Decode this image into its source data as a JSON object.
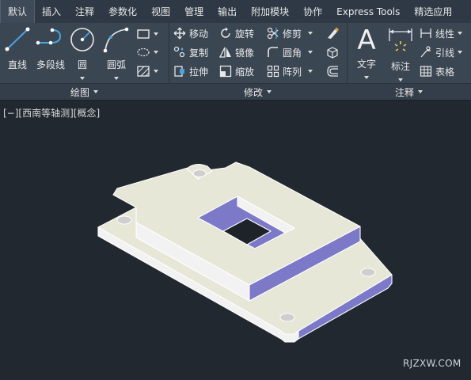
{
  "tabs": [
    {
      "label": "默认",
      "active": true
    },
    {
      "label": "插入"
    },
    {
      "label": "注释"
    },
    {
      "label": "参数化"
    },
    {
      "label": "视图"
    },
    {
      "label": "管理"
    },
    {
      "label": "输出"
    },
    {
      "label": "附加模块"
    },
    {
      "label": "协作"
    },
    {
      "label": "Express Tools"
    },
    {
      "label": "精选应用"
    }
  ],
  "panels": {
    "draw": {
      "title": "绘图",
      "tools": {
        "line": "直线",
        "polyline": "多段线",
        "circle": "圆",
        "arc": "圆弧"
      }
    },
    "modify": {
      "title": "修改",
      "tools": {
        "move": "移动",
        "rotate": "旋转",
        "trim": "修剪",
        "copy": "复制",
        "mirror": "镜像",
        "fillet": "圆角",
        "stretch": "拉伸",
        "scale": "缩放",
        "array": "阵列"
      }
    },
    "annotation": {
      "title": "注释",
      "tools": {
        "text": "文字",
        "dimension": "标注",
        "linear": "线性",
        "leader": "引线",
        "table": "表格"
      },
      "text_icon_glyph": "A"
    }
  },
  "viewport": {
    "controls": "[−]",
    "view": "[西南等轴测]",
    "style": "[概念]"
  },
  "watermark": "RJZXW.COM",
  "colors": {
    "accent": "#4aa3e0",
    "model_top": "#e6e7d6",
    "model_side": "#f2f2f2",
    "model_inner": "#7c79c8",
    "background": "#212830"
  }
}
